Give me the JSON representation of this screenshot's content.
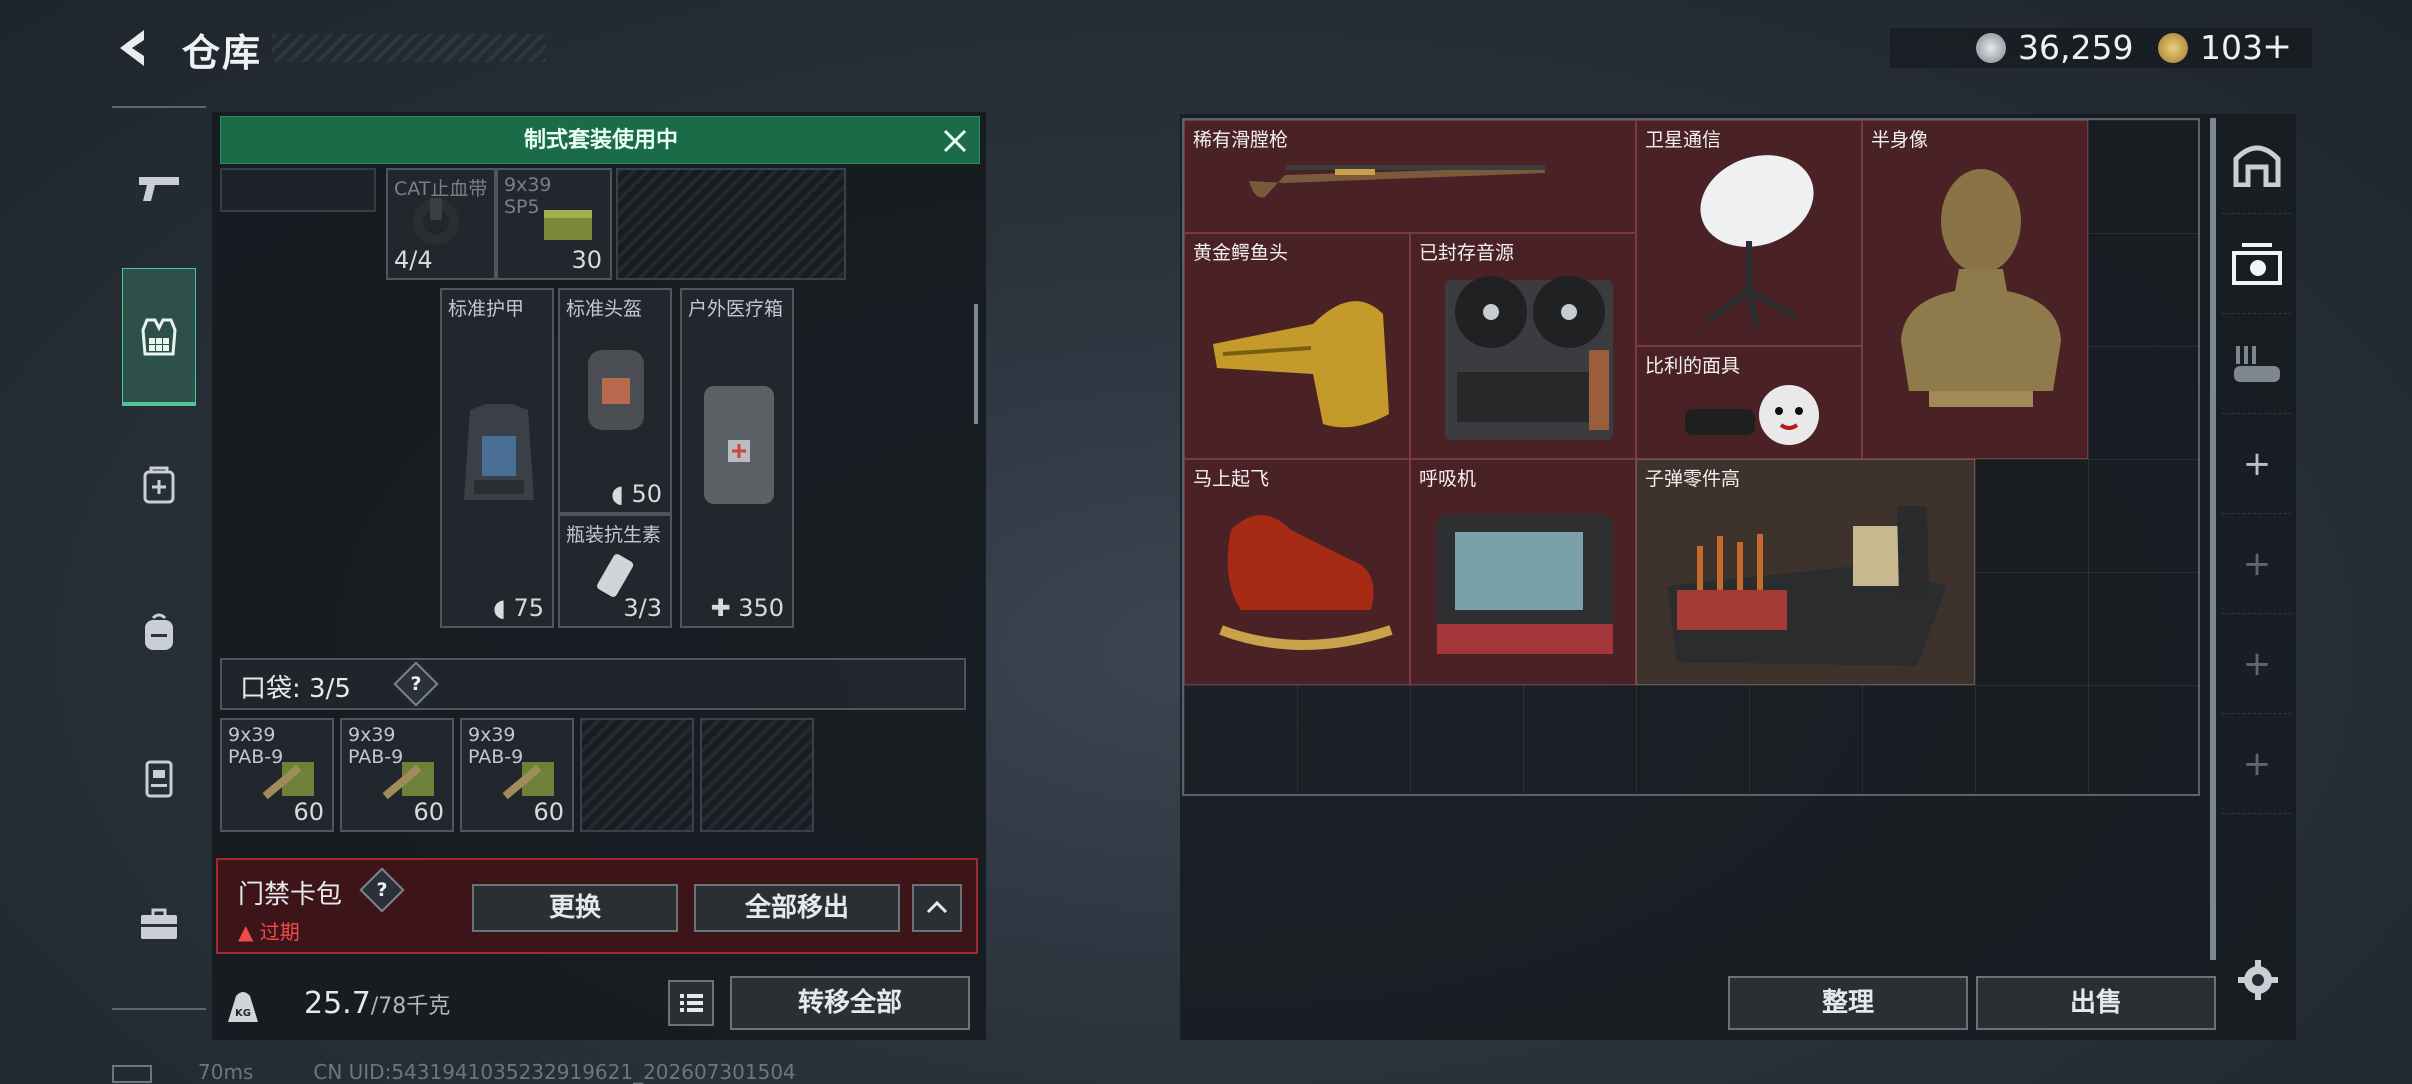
{
  "header": {
    "title": "仓库",
    "currency_1": "36,259",
    "currency_2": "103"
  },
  "banner": {
    "text": "制式套装使用中"
  },
  "gear_slots": [
    {
      "label": "CAT止血带",
      "value": "4/4"
    },
    {
      "label": "9x39",
      "label2": "SP5",
      "value": "30"
    },
    {
      "label": "标准护甲",
      "value": "75"
    },
    {
      "label": "标准头盔",
      "value": "50"
    },
    {
      "label": "户外医疗箱",
      "value": "350"
    },
    {
      "label": "瓶装抗生素",
      "value": "3/3"
    }
  ],
  "pocket": {
    "label": "口袋:",
    "count": "3/5",
    "help": "?",
    "items": [
      {
        "label": "9x39",
        "label2": "PAB-9",
        "value": "60"
      },
      {
        "label": "9x39",
        "label2": "PAB-9",
        "value": "60"
      },
      {
        "label": "9x39",
        "label2": "PAB-9",
        "value": "60"
      }
    ]
  },
  "keycard": {
    "title": "门禁卡包",
    "help": "?",
    "status": "过期",
    "replace_label": "更换",
    "remove_all_label": "全部移出"
  },
  "weight": {
    "current": "25.7",
    "max": "/78千克",
    "transfer_label": "转移全部"
  },
  "stash_items": [
    {
      "name": "稀有滑膛枪",
      "icon": "musket-icon"
    },
    {
      "name": "卫星通信",
      "icon": "satellite-dish-icon"
    },
    {
      "name": "半身像",
      "icon": "bust-statue-icon"
    },
    {
      "name": "黄金鳄鱼头",
      "icon": "golden-crocodile-head-icon"
    },
    {
      "name": "已封存音源",
      "icon": "reel-tape-recorder-icon"
    },
    {
      "name": "比利的面具",
      "icon": "puppet-doll-icon"
    },
    {
      "name": "马上起飞",
      "icon": "rocking-horse-icon"
    },
    {
      "name": "呼吸机",
      "icon": "ventilator-icon"
    },
    {
      "name": "子弹零件高",
      "icon": "ammo-parts-crate-icon"
    }
  ],
  "stash_actions": {
    "sort_label": "整理",
    "sell_label": "出售"
  },
  "status_bar": {
    "ping": "70ms",
    "uid": "CN UID:5431941035232919621_202607301504"
  },
  "colors": {
    "accent_green": "#1b6a48",
    "item_red": "#4a2226",
    "item_brown": "#3d332c",
    "warning_red": "#f04a4a"
  }
}
